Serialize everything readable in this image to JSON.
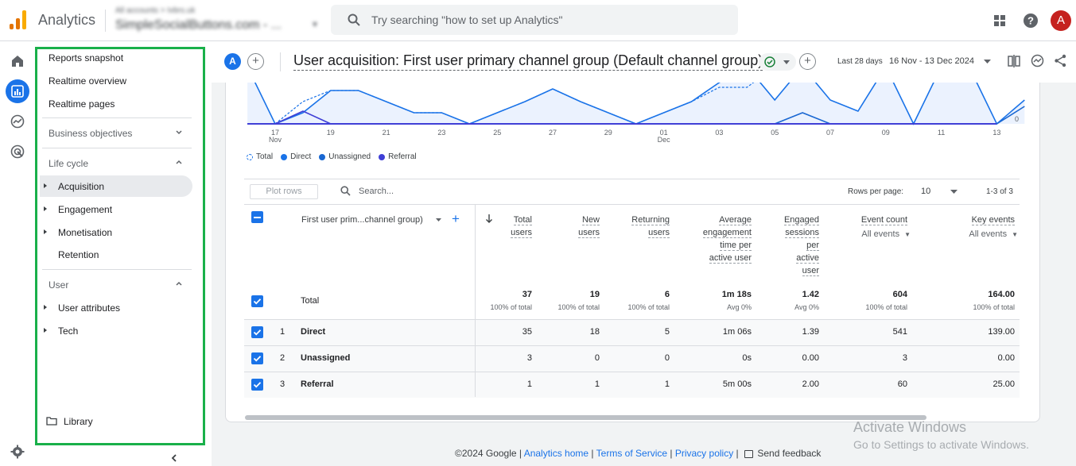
{
  "header": {
    "app_title": "Analytics",
    "account_path": "All accounts > Ivbrs.uk",
    "account_name": "SimpleSocialButtons.com - ...",
    "search_placeholder": "Try searching \"how to set up Analytics\"",
    "avatar_letter": "A"
  },
  "nav": {
    "items_top": [
      "Reports snapshot",
      "Realtime overview",
      "Realtime pages"
    ],
    "business_objectives": "Business objectives",
    "life_cycle": "Life cycle",
    "life_cycle_items": [
      "Acquisition",
      "Engagement",
      "Monetisation",
      "Retention"
    ],
    "user_section": "User",
    "user_items": [
      "User attributes",
      "Tech"
    ],
    "library": "Library"
  },
  "report": {
    "comparison_letter": "A",
    "title": "User acquisition: First user primary channel group (Default channel group)",
    "date_label": "Last 28 days",
    "date_range": "16 Nov - 13 Dec 2024"
  },
  "chart_data": {
    "type": "line",
    "x_tick_labels": [
      "17",
      "19",
      "21",
      "23",
      "25",
      "27",
      "29",
      "01",
      "03",
      "05",
      "07",
      "09",
      "11",
      "13"
    ],
    "x_tick_sublabels": {
      "17": "Nov",
      "01": "Dec"
    },
    "y_tick_labels": [
      "0"
    ],
    "legend": [
      "Total",
      "Direct",
      "Unassigned",
      "Referral"
    ],
    "colors": {
      "Total": "#1a73e8",
      "Direct": "#1a73e8",
      "Unassigned": "#1967d2",
      "Referral": "#3f3fd6"
    }
  },
  "table": {
    "plot_rows": "Plot rows",
    "search_placeholder": "Search...",
    "rows_per_page_label": "Rows per page:",
    "rows_per_page": "10",
    "pagination": "1-3 of 3",
    "dimension_header": "First user prim...channel group)",
    "columns": [
      {
        "lines": [
          "Total",
          "users"
        ]
      },
      {
        "lines": [
          "New",
          "users"
        ]
      },
      {
        "lines": [
          "Returning",
          "users"
        ]
      },
      {
        "lines": [
          "Average",
          "engagement",
          "time per",
          "active user"
        ]
      },
      {
        "lines": [
          "Engaged",
          "sessions",
          "per",
          "active",
          "user"
        ]
      },
      {
        "lines": [
          "Event count"
        ],
        "sub": "All events"
      },
      {
        "lines": [
          "Key events"
        ],
        "sub": "All events"
      }
    ],
    "total_label": "Total",
    "totals": [
      "37",
      "19",
      "6",
      "1m 18s",
      "1.42",
      "604",
      "164.00"
    ],
    "totals_sub": [
      "100% of total",
      "100% of total",
      "100% of total",
      "Avg 0%",
      "Avg 0%",
      "100% of total",
      "100% of total"
    ],
    "rows": [
      {
        "num": "1",
        "label": "Direct",
        "values": [
          "35",
          "18",
          "5",
          "1m 06s",
          "1.39",
          "541",
          "139.00"
        ]
      },
      {
        "num": "2",
        "label": "Unassigned",
        "values": [
          "3",
          "0",
          "0",
          "0s",
          "0.00",
          "3",
          "0.00"
        ]
      },
      {
        "num": "3",
        "label": "Referral",
        "values": [
          "1",
          "1",
          "1",
          "5m 00s",
          "2.00",
          "60",
          "25.00"
        ]
      }
    ]
  },
  "footer": {
    "copyright": "©2024 Google |",
    "analytics_home": "Analytics home",
    "terms": "Terms of Service",
    "privacy": "Privacy policy",
    "sep": "|",
    "feedback": "Send feedback"
  },
  "watermark": {
    "line1": "Activate Windows",
    "line2": "Go to Settings to activate Windows."
  }
}
